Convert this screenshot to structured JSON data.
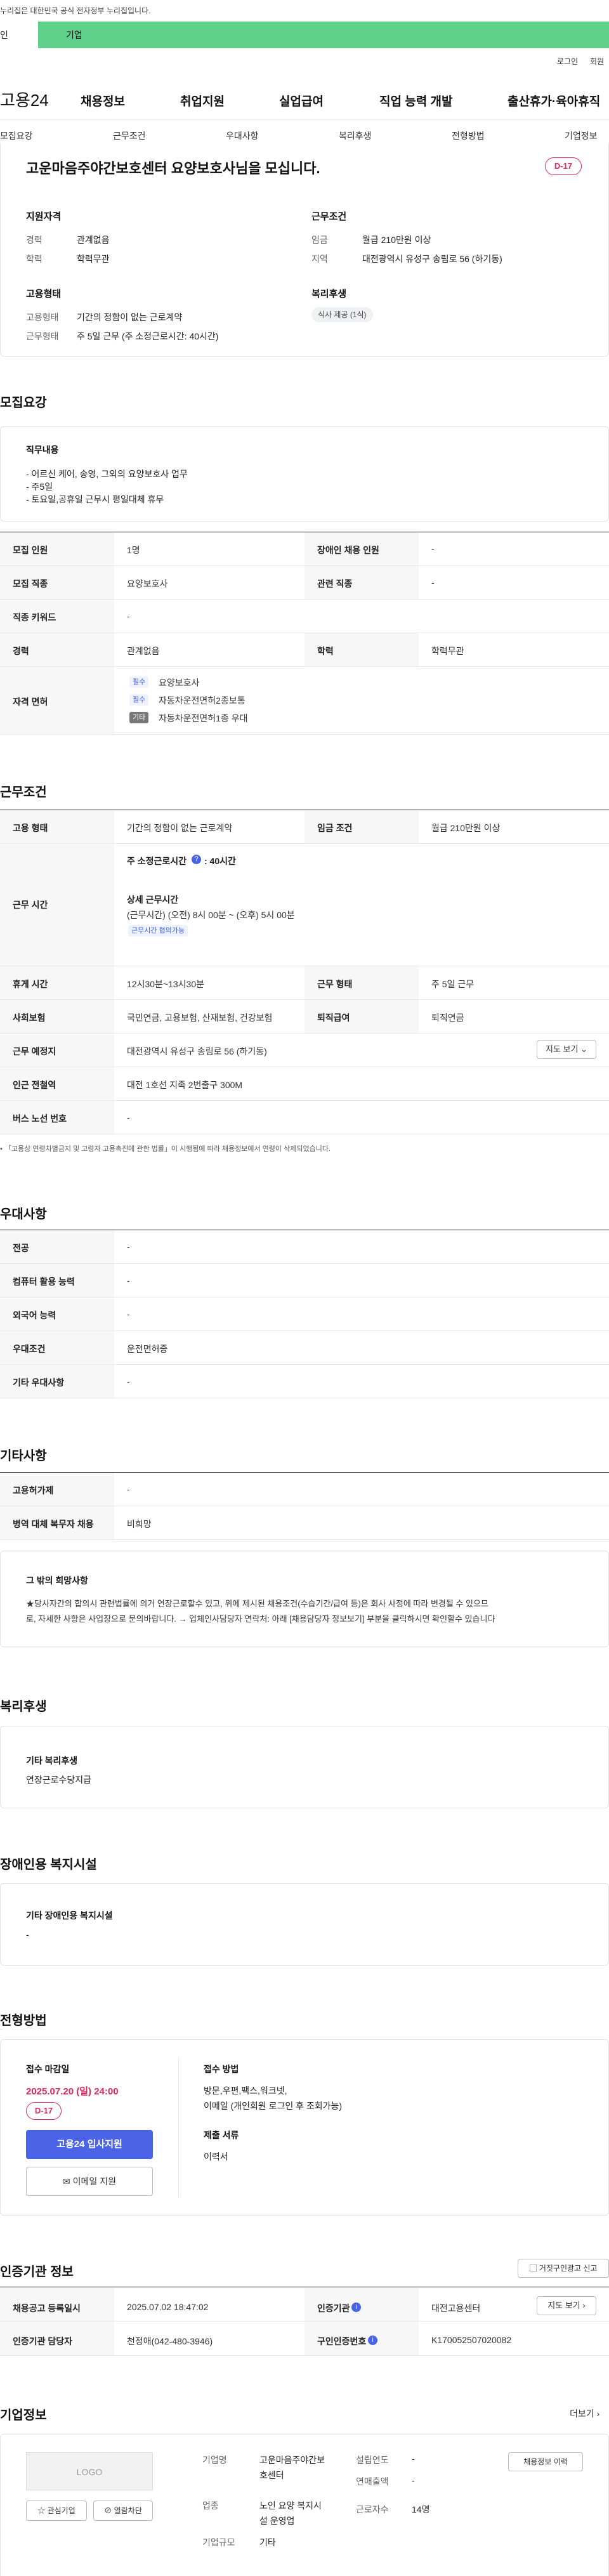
{
  "topbar": {
    "notice": "누리집은 대한민국 공식 전자정부 누리집입니다.",
    "tab_personal": "인",
    "tab_corp": "기업"
  },
  "util": {
    "login": "로그인",
    "join": "회원"
  },
  "logo": "고용24",
  "gnb": [
    "채용정보",
    "취업지원",
    "실업급여",
    "직업 능력 개발",
    "출산휴가·육아휴직"
  ],
  "subnav": [
    "모집요강",
    "근무조건",
    "우대사항",
    "복리후생",
    "전형방법",
    "기업정보"
  ],
  "summary": {
    "title": "고운마음주야간보호센터 요양보호사님을 모십니다.",
    "dday": "D-17",
    "qual_h": "지원자격",
    "career_lbl": "경력",
    "career_val": "관계없음",
    "edu_lbl": "학력",
    "edu_val": "학력무관",
    "cond_h": "근무조건",
    "wage_lbl": "임금",
    "wage_val": "월급 210만원 이상",
    "area_lbl": "지역",
    "area_val": "대전광역시 유성구 송림로 56 (하기동)",
    "emp_h": "고용형태",
    "emptype_lbl": "고용형태",
    "emptype_val": "기간의 정함이 없는 근로계약",
    "worktype_lbl": "근무형태",
    "worktype_val": "주 5일 근무 (주 소정근로시간: 40시간)",
    "welfare_h": "복리후생",
    "welfare_chip": "식사 제공 (1식)"
  },
  "recruit": {
    "title": "모집요강",
    "duty_h": "직무내용",
    "duty_lines": [
      "- 어르신 케어, 송영, 그외의 요양보호사 업무",
      "- 주5일",
      "- 토요일,공휴일 근무시 평일대체 휴무"
    ],
    "rows": [
      {
        "l1": "모집 인원",
        "v1": "1명",
        "l2": "장애인 채용 인원",
        "v2": "-"
      },
      {
        "l1": "모집 직종",
        "v1": "요양보호사",
        "l2": "관련 직종",
        "v2": "-"
      },
      {
        "l1": "직종 키워드",
        "v1": "-"
      },
      {
        "l1": "경력",
        "v1": "관계없음",
        "l2": "학력",
        "v2": "학력무관"
      }
    ],
    "license_lbl": "자격 면허",
    "licenses": [
      {
        "tag": "필수",
        "name": "요양보호사"
      },
      {
        "tag": "필수",
        "name": "자동차운전면허2종보통"
      },
      {
        "tag": "기타",
        "name": "자동차운전면허1종 우대"
      }
    ]
  },
  "work": {
    "title": "근무조건",
    "r1": {
      "l1": "고용 형태",
      "v1": "기간의 정함이 없는 근로계약",
      "l2": "임금 조건",
      "v2": "월급 210만원 이상"
    },
    "time_lbl": "근무 시간",
    "time_weekly": "주 소정근로시간",
    "time_weekly_val": ": 40시간",
    "time_detail_h": "상세 근무시간",
    "time_detail": "(근무시간) (오전) 8시 00분 ~ (오후) 5시 00분",
    "time_tag": "근무시간 협의가능",
    "r2": {
      "l1": "휴게 시간",
      "v1": "12시30분~13시30분",
      "l2": "근무 형태",
      "v2": "주 5일 근무"
    },
    "r3": {
      "l1": "사회보험",
      "v1": "국민연금, 고용보험, 산재보험, 건강보험",
      "l2": "퇴직급여",
      "v2": "퇴직연금"
    },
    "r4": {
      "l1": "근무 예정지",
      "v1": "대전광역시 유성구 송림로 56 (하기동)",
      "btn": "지도 보기"
    },
    "r5": {
      "l1": "인근 전철역",
      "v1": "대전 1호선 지족 2번출구 300M"
    },
    "r6": {
      "l1": "버스 노선 번호",
      "v1": "-"
    },
    "note": "「고용상 연령차별금지 및 고령자 고용촉진에 관한 법률」이 시행됨에 따라 채용정보에서 연령이 삭제되었습니다."
  },
  "pref": {
    "title": "우대사항",
    "rows": [
      {
        "l": "전공",
        "v": "-"
      },
      {
        "l": "컴퓨터 활용 능력",
        "v": "-"
      },
      {
        "l": "외국어 능력",
        "v": "-"
      },
      {
        "l": "우대조건",
        "v": "운전면허증"
      },
      {
        "l": "기타 우대사항",
        "v": "-"
      }
    ]
  },
  "etc": {
    "title": "기타사항",
    "rows": [
      {
        "l": "고용허가제",
        "v": "-"
      },
      {
        "l": "병역 대체 복무자 채용",
        "v": "비희망"
      }
    ],
    "box_h": "그 밖의 희망사항",
    "box_text1": "★당사자간의 합의시 관련법률에 의거 연장근로할수 있고, 위에 제시된 채용조건(수습기간/급여 등)은 회사 사정에 따라 변경될 수 있으므",
    "box_text2": "로, 자세한 사항은  사업장으로 문의바랍니다. → 업체인사담당자 연락처: 아래 [채용담당자 정보보기] 부분을 클릭하시면 확인할수 있습니다"
  },
  "welfare": {
    "title": "복리후생",
    "box_h": "기타 복리후생",
    "box_v": "연장근로수당지급"
  },
  "disabled": {
    "title": "장애인용 복지시설",
    "box_h": "기타 장애인용 복지시설",
    "box_v": "-"
  },
  "apply": {
    "title": "전형방법",
    "deadline_h": "접수 마감일",
    "deadline": "2025.07.20 (일) 24:00",
    "dday": "D-17",
    "apply_btn": "고용24 입사지원",
    "email_btn": "이메일 지원",
    "method_h": "접수 방법",
    "method1": "방문,우편,팩스,워크넷,",
    "method2": "이메일 (개인회원 로그인 후 조회가능)",
    "docs_h": "제출 서류",
    "docs": "이력서"
  },
  "cert": {
    "title": "인증기관 정보",
    "report_btn": "거짓구인광고 신고",
    "rows": [
      {
        "l1": "채용공고 등록일시",
        "v1": "2025.07.02 18:47:02",
        "l2": "인증기관",
        "v2": "대전고용센터",
        "btn": "지도 보기"
      },
      {
        "l1": "인증기관 담당자",
        "v1": "천정애(042-480-3946)",
        "l2": "구인인증번호",
        "v2": "K170052507020082"
      }
    ]
  },
  "company": {
    "title": "기업정보",
    "more": "더보기",
    "logo_text": "LOGO",
    "fav_btn": "관심기업",
    "block_btn": "열람차단",
    "name_lbl": "기업명",
    "name_val1": "고운마음주야간보",
    "name_val2": "호센터",
    "found_lbl": "설립연도",
    "found_val": "-",
    "sales_lbl": "연매출액",
    "sales_val": "-",
    "ind_lbl": "업종",
    "ind_val1": "노인 요양 복지시",
    "ind_val2": "설 운영업",
    "emp_lbl": "근로자수",
    "emp_val": "14명",
    "size_lbl": "기업규모",
    "size_val": "기타",
    "history_btn": "채용정보 이력"
  }
}
